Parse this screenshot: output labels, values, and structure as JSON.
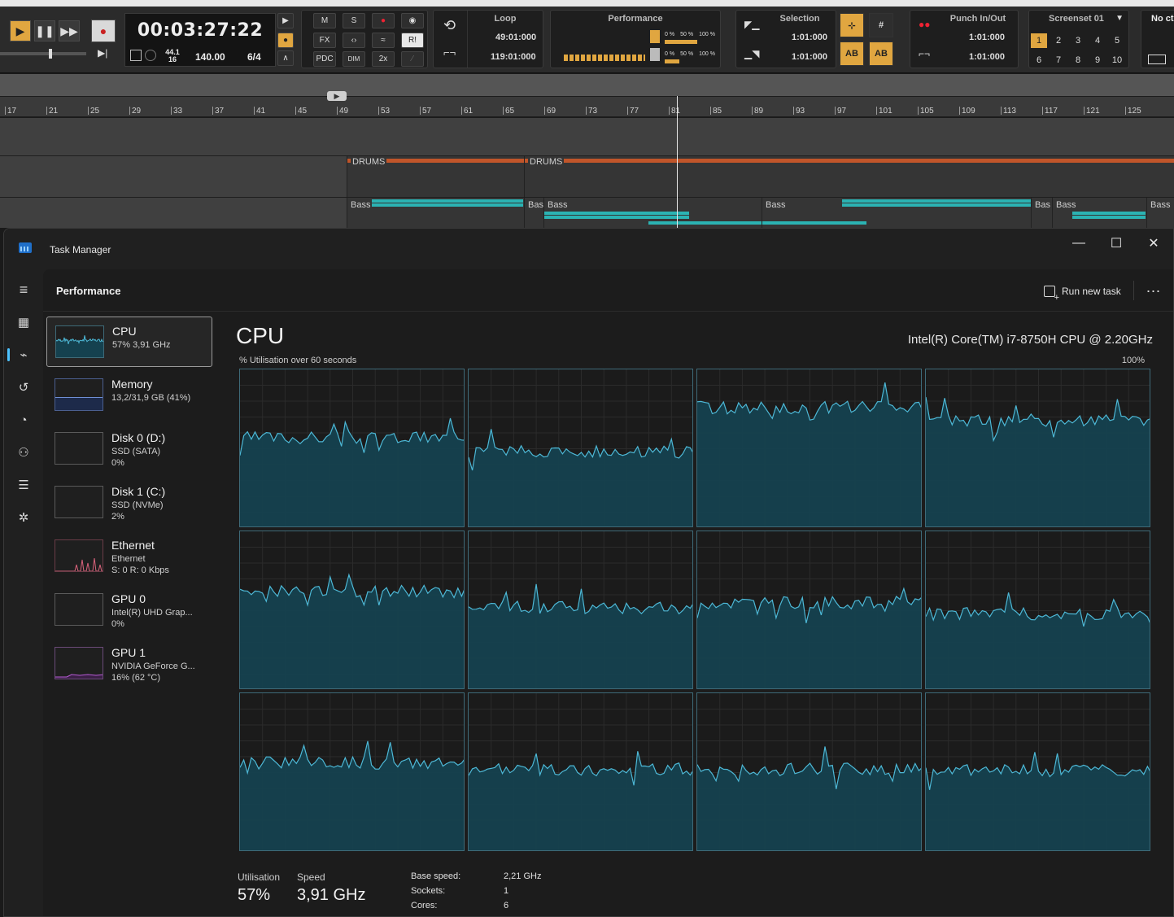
{
  "daw": {
    "clock": {
      "time": "00:03:27:22",
      "sample_rate": "44.1",
      "bit_depth": "16",
      "tempo": "140.00",
      "meter": "6/4"
    },
    "mix_buttons": {
      "m": "M",
      "s": "S",
      "fx": "FX",
      "pdc": "PDC",
      "dim": "DIM",
      "two_x": "2x",
      "ri": "R!"
    },
    "loop": {
      "title": "Loop",
      "start": "49:01:000",
      "end": "119:01:000"
    },
    "performance": {
      "title": "Performance",
      "zero": "0 %",
      "fifty": "50 %",
      "hundred": "100 %"
    },
    "selection": {
      "title": "Selection",
      "start": "1:01:000",
      "end": "1:01:000"
    },
    "punch": {
      "title": "Punch In/Out",
      "start": "1:01:000",
      "end": "1:01:000"
    },
    "screenset": {
      "title": "Screenset 01",
      "numbers": [
        "1",
        "2",
        "3",
        "4",
        "5",
        "6",
        "7",
        "8",
        "9",
        "10"
      ]
    },
    "right_label": "No ct",
    "ruler_ticks": [
      "17",
      "21",
      "25",
      "29",
      "33",
      "37",
      "41",
      "45",
      "49",
      "53",
      "57",
      "61",
      "65",
      "69",
      "73",
      "77",
      "81",
      "85",
      "89",
      "93",
      "97",
      "101",
      "105",
      "109",
      "113",
      "117",
      "121",
      "125"
    ],
    "clips": [
      {
        "label": "DRUMS"
      },
      {
        "label": "DRUMS"
      },
      {
        "label": "Bass"
      },
      {
        "label": "Bas"
      },
      {
        "label": "Bass"
      },
      {
        "label": "Bass"
      },
      {
        "label": "Bas"
      },
      {
        "label": "Bass"
      },
      {
        "label": "Bass"
      }
    ]
  },
  "tm": {
    "title": "Task Manager",
    "header": {
      "title": "Performance",
      "run_new_task": "Run new task"
    },
    "items": [
      {
        "name": "CPU",
        "l2": "57% 3,91 GHz",
        "l3": ""
      },
      {
        "name": "Memory",
        "l2": "13,2/31,9 GB (41%)",
        "l3": ""
      },
      {
        "name": "Disk 0 (D:)",
        "l2": "SSD (SATA)",
        "l3": "0%"
      },
      {
        "name": "Disk 1 (C:)",
        "l2": "SSD (NVMe)",
        "l3": "2%"
      },
      {
        "name": "Ethernet",
        "l2": "Ethernet",
        "l3": "S: 0  R: 0 Kbps"
      },
      {
        "name": "GPU 0",
        "l2": "Intel(R) UHD Grap...",
        "l3": "0%"
      },
      {
        "name": "GPU 1",
        "l2": "NVIDIA GeForce G...",
        "l3": "16% (62 °C)"
      }
    ],
    "cpu": {
      "title": "CPU",
      "model": "Intel(R) Core(TM) i7-8750H CPU @ 2.20GHz",
      "graph_label": "% Utilisation over 60 seconds",
      "max_label": "100%",
      "core_levels_percent": [
        57,
        48,
        76,
        68,
        62,
        52,
        55,
        48,
        56,
        52,
        52,
        51
      ]
    },
    "stats": {
      "utilisation_label": "Utilisation",
      "utilisation": "57%",
      "speed_label": "Speed",
      "speed": "3,91 GHz",
      "base_speed_label": "Base speed:",
      "base_speed": "2,21 GHz",
      "sockets_label": "Sockets:",
      "sockets": "1",
      "cores_label": "Cores:",
      "cores": "6"
    },
    "colors": {
      "cpu_line": "#4db8d6",
      "cpu_fill": "#15414f",
      "memory": "#6f8fd6",
      "ethernet": "#d9627b",
      "gpu": "#b85cd6",
      "accent": "#4cc2ff"
    }
  }
}
